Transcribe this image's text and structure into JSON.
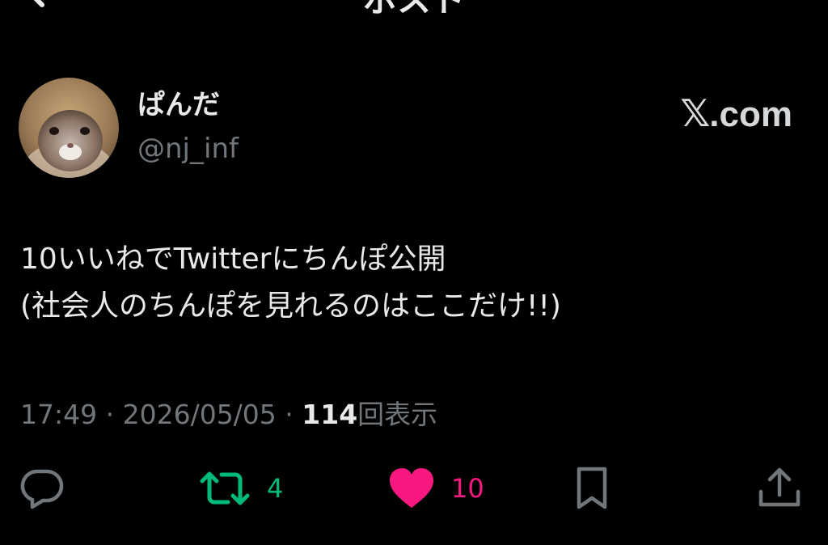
{
  "header": {
    "title": "ポスト",
    "back_icon": "arrow-left-icon",
    "more_icon": "more-icon"
  },
  "author": {
    "display_name": "ぱんだ",
    "handle": "@nj_inf",
    "avatar": "hamster-avatar"
  },
  "brand": {
    "logo_text": ".com",
    "logo_glyph": "𝕏"
  },
  "post": {
    "text": "10いいねでTwitterにちんぽ公開\n(社会人のちんぽを見れるのはここだけ!!)"
  },
  "meta": {
    "time": "17:49",
    "separator": " · ",
    "date": "2026/05/05",
    "views_count": "114",
    "views_label": "回表示"
  },
  "actions": {
    "reply": {
      "icon": "reply-icon"
    },
    "retweet": {
      "icon": "retweet-icon",
      "count": "4"
    },
    "like": {
      "icon": "heart-icon",
      "count": "10"
    },
    "bookmark": {
      "icon": "bookmark-icon"
    },
    "share": {
      "icon": "share-icon"
    }
  },
  "colors": {
    "background": "#000000",
    "text": "#e7e9ea",
    "secondary": "#71767b",
    "retweet": "#00ba7c",
    "like": "#f91880"
  }
}
